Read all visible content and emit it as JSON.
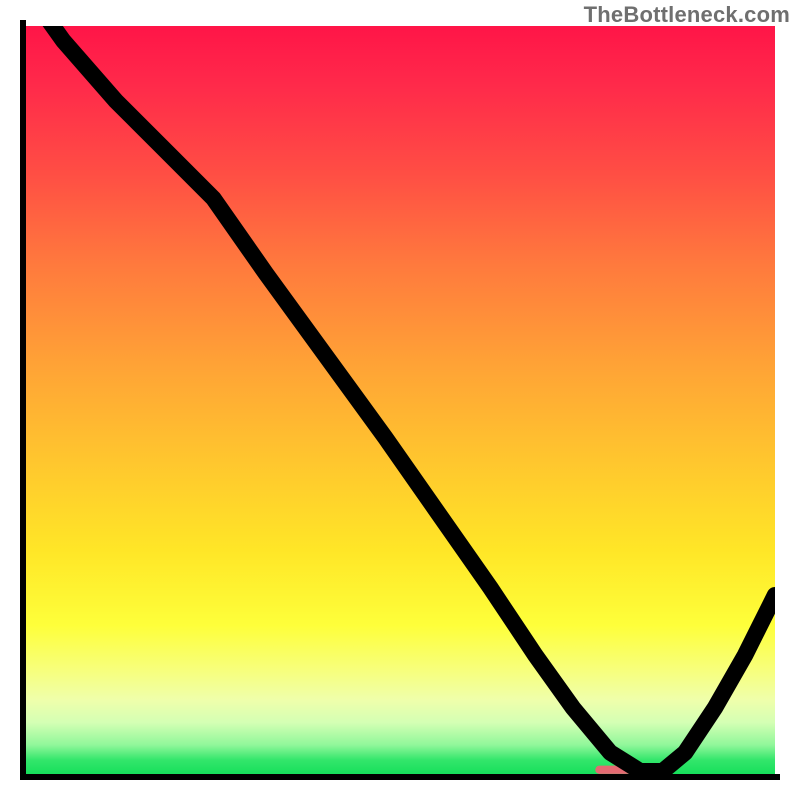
{
  "watermark": "TheBottleneck.com",
  "colors": {
    "gradient_top": "#ff1548",
    "gradient_mid1": "#ff7a3d",
    "gradient_mid2": "#ffe627",
    "gradient_bottom": "#14df5a",
    "curve": "#000000",
    "marker": "#e46a72",
    "axis": "#000000"
  },
  "chart_data": {
    "type": "line",
    "title": "",
    "xlabel": "",
    "ylabel": "",
    "xlim": [
      0,
      100
    ],
    "ylim": [
      0,
      100
    ],
    "x": [
      0,
      5,
      12,
      18,
      25,
      32,
      40,
      48,
      55,
      62,
      68,
      73,
      78,
      82,
      85,
      88,
      92,
      96,
      100
    ],
    "values": [
      105,
      98,
      90,
      84,
      77,
      67,
      56,
      45,
      35,
      25,
      16,
      9,
      3,
      0.5,
      0.5,
      3,
      9,
      16,
      24
    ],
    "minimum_marker": {
      "x_start": 76,
      "x_end": 86,
      "y": 0.7
    },
    "note": "Values are approximate percentages of plot height read from the image; the curve descends from top-left, bends near x≈25, reaches ≈0 around x≈80–85, then rises toward the right edge."
  }
}
